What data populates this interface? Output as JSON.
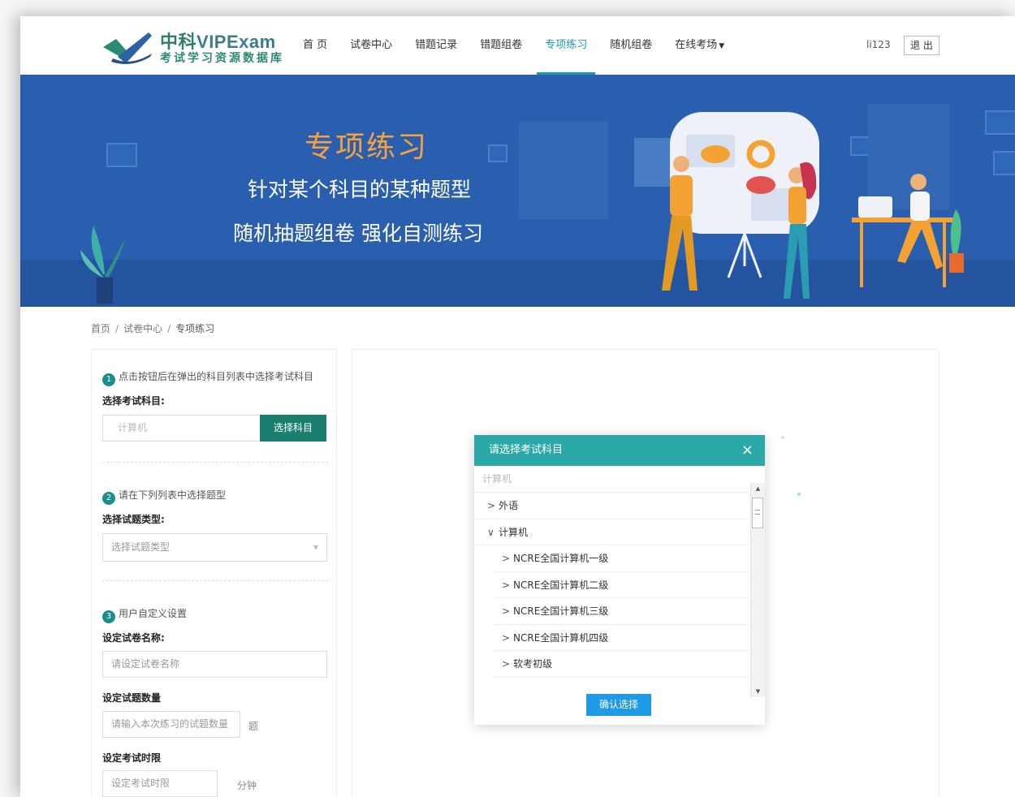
{
  "logo": {
    "brand_cn": "中科",
    "brand_en": "VIPExam",
    "subtitle": "考试学习资源数据库"
  },
  "nav": {
    "items": [
      {
        "label": "首 页",
        "active": false
      },
      {
        "label": "试卷中心",
        "active": false
      },
      {
        "label": "错题记录",
        "active": false
      },
      {
        "label": "错题组卷",
        "active": false
      },
      {
        "label": "专项练习",
        "active": true
      },
      {
        "label": "随机组卷",
        "active": false
      },
      {
        "label": "在线考场",
        "active": false,
        "has_dropdown": true
      }
    ]
  },
  "user": {
    "name": "li123",
    "logout_label": "退 出"
  },
  "banner": {
    "title": "专项练习",
    "line1": "针对某个科目的某种题型",
    "line2": "随机抽题组卷 强化自测练习"
  },
  "breadcrumb": {
    "home": "首页",
    "sep": "/",
    "middle": "试卷中心",
    "current": "专项练习"
  },
  "form": {
    "step1": {
      "num": "1",
      "text": "点击按钮后在弹出的科目列表中选择考试科目"
    },
    "subject_label": "选择考试科目:",
    "subject_value": "计算机",
    "choose_button": "选择科目",
    "step2": {
      "num": "2",
      "text": "请在下列列表中选择题型"
    },
    "type_label": "选择试题类型:",
    "type_placeholder": "选择试题类型",
    "step3": {
      "num": "3",
      "text": "用户自定义设置"
    },
    "name_label": "设定试卷名称:",
    "name_placeholder": "请设定试卷名称",
    "count_label": "设定试题数量",
    "count_placeholder": "请输入本次练习的试题数量",
    "count_unit": "题",
    "time_label": "设定考试时限",
    "time_placeholder": "设定考试时限",
    "time_unit": "分钟"
  },
  "modal": {
    "title": "请选择考试科目",
    "close": "×",
    "search_value": "计算机",
    "tree": [
      {
        "label": "外语",
        "level": 1,
        "expanded": false
      },
      {
        "label": "计算机",
        "level": 1,
        "expanded": true
      },
      {
        "label": "NCRE全国计算机一级",
        "level": 2,
        "expanded": false
      },
      {
        "label": "NCRE全国计算机二级",
        "level": 2,
        "expanded": false
      },
      {
        "label": "NCRE全国计算机三级",
        "level": 2,
        "expanded": false
      },
      {
        "label": "NCRE全国计算机四级",
        "level": 2,
        "expanded": false
      },
      {
        "label": "软考初级",
        "level": 2,
        "expanded": false
      }
    ],
    "confirm_button": "确认选择"
  },
  "colors": {
    "accent": "#1a9aa6",
    "banner_bg": "#2a5fb0",
    "banner_title": "#f7a13c",
    "modal_header": "#2aa9a8",
    "primary_button": "#1b7f6f",
    "confirm_button": "#1e9ae8"
  }
}
